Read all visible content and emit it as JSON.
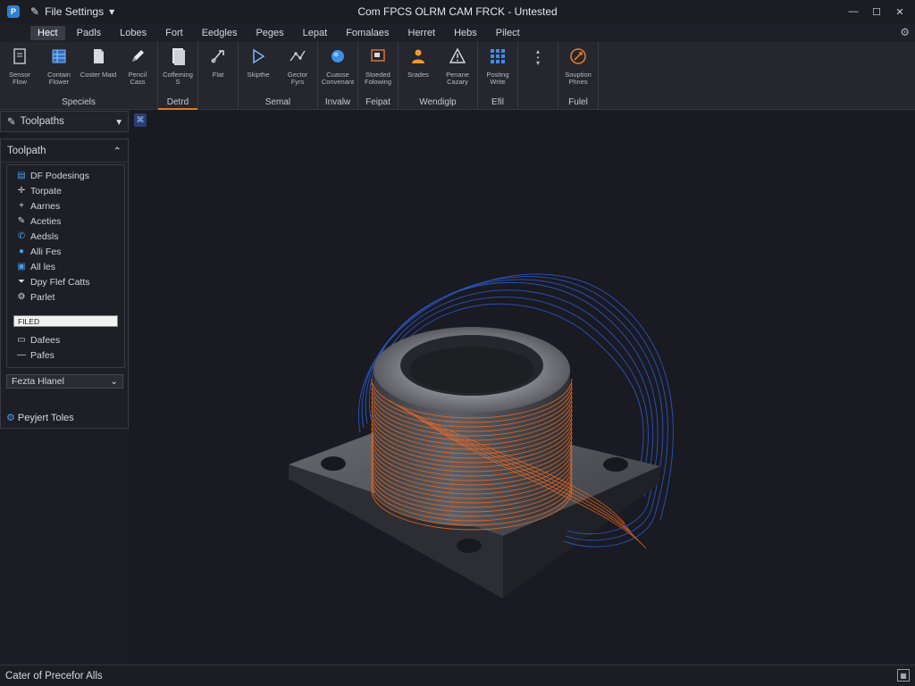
{
  "window": {
    "logo": "P",
    "quick_access": "File Settings",
    "title": "Com FPCS OLRM CAM FRCK - Untested",
    "controls": [
      "minimize-icon",
      "maximize-icon",
      "close-icon"
    ]
  },
  "menu": {
    "items": [
      "Hect",
      "Padls",
      "Lobes",
      "Fort",
      "Eedgles",
      "Peges",
      "Lepat",
      "Fomalaes",
      "Herret",
      "Hebs",
      "Pilect"
    ],
    "active_index": 0
  },
  "ribbon": {
    "groups": [
      {
        "label": "Speciels",
        "buttons": [
          {
            "label": "Sensor\nFlow",
            "icon": "document-icon"
          },
          {
            "label": "Contain\nFlower",
            "icon": "grid-icon"
          },
          {
            "label": "Coster Maid",
            "icon": "file-icon"
          },
          {
            "label": "Pencil\nCass",
            "icon": "pen-icon"
          }
        ]
      },
      {
        "label": "Detrd",
        "active": true,
        "buttons": [
          {
            "label": "Colfeming\nS",
            "icon": "page-icon"
          }
        ]
      },
      {
        "label": "",
        "buttons": [
          {
            "label": "Flat",
            "icon": "tool-icon"
          }
        ]
      },
      {
        "label": "Semal",
        "buttons": [
          {
            "label": "Skipthe",
            "icon": "play-icon"
          },
          {
            "label": "Gector\nFyrs",
            "icon": "curve-icon"
          }
        ]
      },
      {
        "label": "Invalw",
        "buttons": [
          {
            "label": "Cuasse\nConvenant",
            "icon": "sphere-icon"
          }
        ]
      },
      {
        "label": "Feipat",
        "buttons": [
          {
            "label": "Stoeded\nFolowing",
            "icon": "frame-icon"
          }
        ]
      },
      {
        "label": "Wendiglp",
        "buttons": [
          {
            "label": "Srades",
            "icon": "user-icon"
          },
          {
            "label": "Penane\nCazary",
            "icon": "warning-icon"
          }
        ]
      },
      {
        "label": "Efil",
        "buttons": [
          {
            "label": "Posting\nWrite",
            "icon": "tiles-icon"
          }
        ]
      },
      {
        "label": "",
        "buttons": [
          {
            "label": "",
            "icon": "more-icon"
          }
        ]
      },
      {
        "label": "Fulel",
        "buttons": [
          {
            "label": "Souption\nPhnes",
            "icon": "compass-icon"
          }
        ]
      }
    ]
  },
  "left_panel": {
    "header": "Toolpaths",
    "title": "Toolpath",
    "items": [
      {
        "label": "DF Podesings",
        "icon": "folder-icon",
        "color": "#4a9be8"
      },
      {
        "label": "Torpate",
        "icon": "move-icon",
        "color": "#d6d8de"
      },
      {
        "label": "Aarnes",
        "icon": "plus-icon",
        "color": "#d6d8de"
      },
      {
        "label": "Aceties",
        "icon": "pencil-icon",
        "color": "#d6d8de"
      },
      {
        "label": "Aedsls",
        "icon": "phone-icon",
        "color": "#4a9be8"
      },
      {
        "label": "Alli Fes",
        "icon": "dot-icon",
        "color": "#4a9be8"
      },
      {
        "label": "All les",
        "icon": "image-icon",
        "color": "#4a9be8"
      },
      {
        "label": "Dpy Flef Catts",
        "icon": "filter-icon",
        "color": "#d6d8de"
      },
      {
        "label": "Parlet",
        "icon": "gear-icon",
        "color": "#d6d8de"
      }
    ],
    "filter_value": "FILED",
    "items2": [
      {
        "label": "Dafees",
        "icon": "folder-outline-icon"
      },
      {
        "label": "Pafes",
        "icon": "dash-icon"
      }
    ],
    "combo": "Fezta Hlanel",
    "footer": "Peyjert Toles"
  },
  "status": {
    "text": "Cater of Precefor Alls",
    "right_icon": "grid-small-icon"
  },
  "colors": {
    "accent": "#d97a2a",
    "toolpath_orange": "#f06820",
    "toolpath_blue": "#2f5fd8",
    "background": "#191a22"
  }
}
